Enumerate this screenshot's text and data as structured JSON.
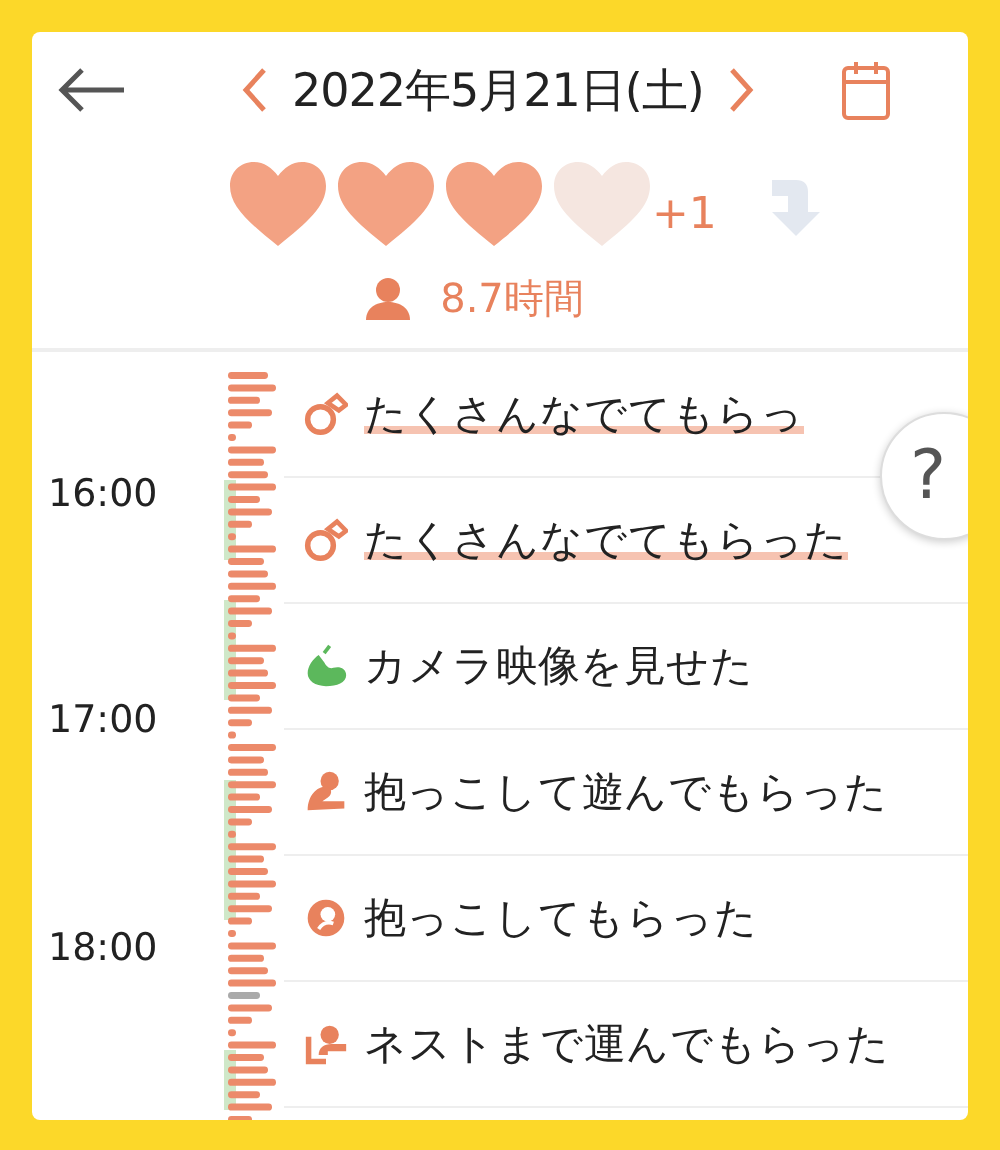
{
  "header": {
    "date": "2022年5月21日(土)"
  },
  "hearts": {
    "items": [
      {
        "filled": true
      },
      {
        "filled": true
      },
      {
        "filled": true
      },
      {
        "filled": false
      }
    ],
    "extra": "+1"
  },
  "duration": "8.7時間",
  "times": [
    "16:00",
    "17:00",
    "18:00"
  ],
  "events": [
    {
      "kind": "stroke",
      "label": "たくさんなでてもらっ",
      "highlighted": true
    },
    {
      "kind": "stroke",
      "label": "たくさんなでてもらった",
      "highlighted": true
    },
    {
      "kind": "camera",
      "label": "カメラ映像を見せた",
      "highlighted": false
    },
    {
      "kind": "hold-play",
      "label": "抱っこして遊んでもらった",
      "highlighted": false
    },
    {
      "kind": "hold",
      "label": "抱っこしてもらった",
      "highlighted": false
    },
    {
      "kind": "carry",
      "label": "ネストまで運んでもらった",
      "highlighted": false
    }
  ],
  "help": "?"
}
